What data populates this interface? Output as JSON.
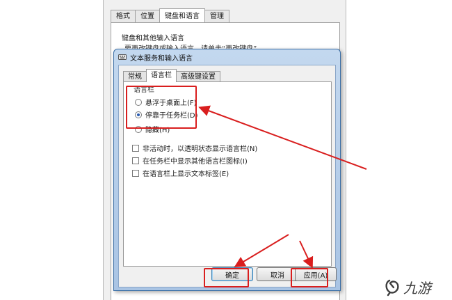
{
  "background_dialog": {
    "tabs": [
      {
        "label": "格式"
      },
      {
        "label": "位置"
      },
      {
        "label": "键盘和语言"
      },
      {
        "label": "管理"
      }
    ],
    "heading": "键盘和其他输入语言",
    "hint": "要更改键盘或输入语言，请单击“更改键盘”"
  },
  "dialog": {
    "title": "文本服务和输入语言",
    "tabs": [
      {
        "label": "常规"
      },
      {
        "label": "语言栏"
      },
      {
        "label": "高级键设置"
      }
    ],
    "group_label": "语言栏",
    "radios": [
      {
        "label": "悬浮于桌面上(F)",
        "checked": false
      },
      {
        "label": "停靠于任务栏(D)",
        "checked": true
      },
      {
        "label": "隐藏(H)",
        "checked": false
      }
    ],
    "checkboxes": [
      {
        "label": "非活动时，以透明状态显示语言栏(N)",
        "checked": false
      },
      {
        "label": "在任务栏中显示其他语言栏图标(I)",
        "checked": false
      },
      {
        "label": "在语言栏上显示文本标签(E)",
        "checked": false
      }
    ],
    "buttons": {
      "ok": "确定",
      "cancel": "取消",
      "apply": "应用(A)"
    }
  },
  "annotations": {
    "color": "#d91e1e"
  },
  "watermark": {
    "text": "九游"
  }
}
